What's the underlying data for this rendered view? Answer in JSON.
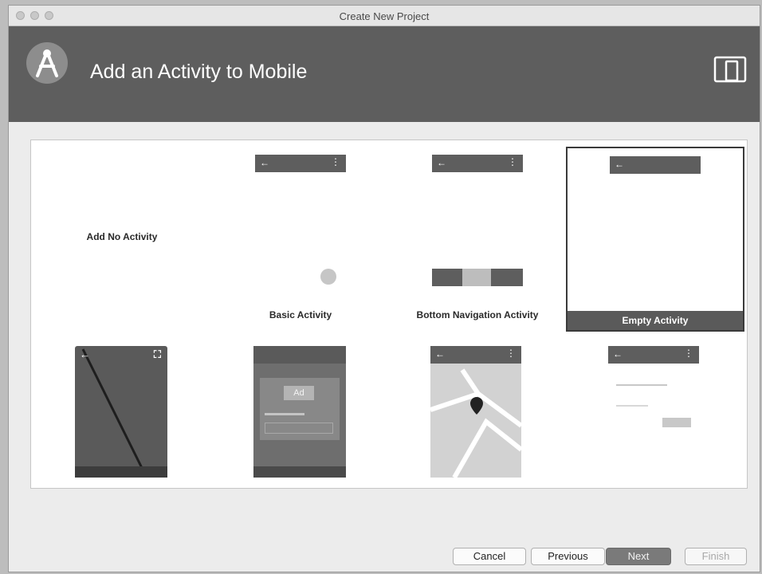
{
  "window": {
    "title": "Create New Project"
  },
  "banner": {
    "title": "Add an Activity to Mobile",
    "logo_icon": "android-studio-logo-icon",
    "device_icon": "phone-tablet-icon"
  },
  "gallery": {
    "tiles": [
      {
        "label": "Add No Activity",
        "selected": false
      },
      {
        "label": "Basic Activity",
        "selected": false
      },
      {
        "label": "Bottom Navigation Activity",
        "selected": false
      },
      {
        "label": "Empty Activity",
        "selected": true
      },
      {
        "label": "",
        "selected": false
      },
      {
        "label": "",
        "selected": false
      },
      {
        "label": "",
        "selected": false
      },
      {
        "label": "",
        "selected": false
      }
    ],
    "ad_text": "Ad"
  },
  "buttons": {
    "cancel": "Cancel",
    "previous": "Previous",
    "next": "Next",
    "finish": "Finish"
  },
  "colors": {
    "banner": "#5e5e5e",
    "selection": "#5a5a5a",
    "gallery_bg": "#ffffff"
  }
}
